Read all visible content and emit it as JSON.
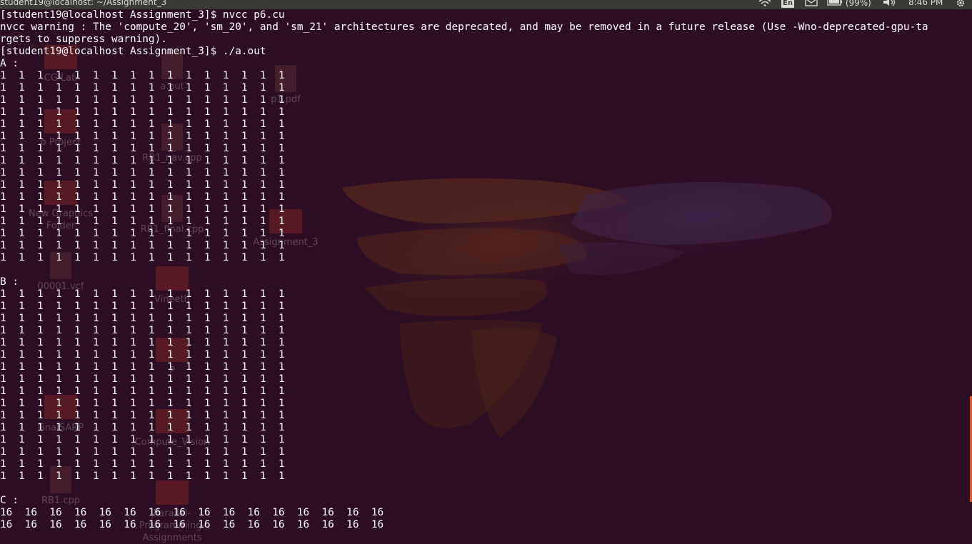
{
  "topbar": {
    "window_title": "student19@localhost: ~/Assignment_3",
    "keyboard": "En",
    "battery": "(99%)",
    "time": "8:46 PM"
  },
  "desktop_icons": [
    {
      "label": "CG Lab",
      "kind": "folder"
    },
    {
      "label": "a.out",
      "kind": "file"
    },
    {
      "label": "p1.pdf",
      "kind": "file"
    },
    {
      "label": "o Project",
      "kind": "folder"
    },
    {
      "label": "RB1_nav.cpp",
      "kind": "file"
    },
    {
      "label": "New Graphics Folder",
      "kind": "folder"
    },
    {
      "label": "RB1_final.cpp",
      "kind": "file"
    },
    {
      "label": "Assignment_3",
      "kind": "folder"
    },
    {
      "label": "00001.vcf",
      "kind": "file"
    },
    {
      "label": "Vineeth",
      "kind": "folder"
    },
    {
      "label": "P",
      "kind": "folder"
    },
    {
      "label": "FinalSARP",
      "kind": "folder"
    },
    {
      "label": "Compute_Vision",
      "kind": "folder"
    },
    {
      "label": "RB1.cpp",
      "kind": "file"
    },
    {
      "label": "Parallel-Programming-Assignments",
      "kind": "folder"
    }
  ],
  "terminal": {
    "lines": [
      "[student19@localhost Assignment_3]$ nvcc p6.cu",
      "nvcc warning : The 'compute_20', 'sm_20', and 'sm_21' architectures are deprecated, and may be removed in a future release (Use -Wno-deprecated-gpu-ta",
      "rgets to suppress warning).",
      "[student19@localhost Assignment_3]$ ./a.out",
      "A :",
      "1  1  1  1  1  1  1  1  1  1  1  1  1  1  1  1",
      "1  1  1  1  1  1  1  1  1  1  1  1  1  1  1  1",
      "1  1  1  1  1  1  1  1  1  1  1  1  1  1  1  1",
      "1  1  1  1  1  1  1  1  1  1  1  1  1  1  1  1",
      "1  1  1  1  1  1  1  1  1  1  1  1  1  1  1  1",
      "1  1  1  1  1  1  1  1  1  1  1  1  1  1  1  1",
      "1  1  1  1  1  1  1  1  1  1  1  1  1  1  1  1",
      "1  1  1  1  1  1  1  1  1  1  1  1  1  1  1  1",
      "1  1  1  1  1  1  1  1  1  1  1  1  1  1  1  1",
      "1  1  1  1  1  1  1  1  1  1  1  1  1  1  1  1",
      "1  1  1  1  1  1  1  1  1  1  1  1  1  1  1  1",
      "1  1  1  1  1  1  1  1  1  1  1  1  1  1  1  1",
      "1  1  1  1  1  1  1  1  1  1  1  1  1  1  1  1",
      "1  1  1  1  1  1  1  1  1  1  1  1  1  1  1  1",
      "1  1  1  1  1  1  1  1  1  1  1  1  1  1  1  1",
      "1  1  1  1  1  1  1  1  1  1  1  1  1  1  1  1",
      "",
      "B :",
      "1  1  1  1  1  1  1  1  1  1  1  1  1  1  1  1",
      "1  1  1  1  1  1  1  1  1  1  1  1  1  1  1  1",
      "1  1  1  1  1  1  1  1  1  1  1  1  1  1  1  1",
      "1  1  1  1  1  1  1  1  1  1  1  1  1  1  1  1",
      "1  1  1  1  1  1  1  1  1  1  1  1  1  1  1  1",
      "1  1  1  1  1  1  1  1  1  1  1  1  1  1  1  1",
      "1  1  1  1  1  1  1  1  1  1  1  1  1  1  1  1",
      "1  1  1  1  1  1  1  1  1  1  1  1  1  1  1  1",
      "1  1  1  1  1  1  1  1  1  1  1  1  1  1  1  1",
      "1  1  1  1  1  1  1  1  1  1  1  1  1  1  1  1",
      "1  1  1  1  1  1  1  1  1  1  1  1  1  1  1  1",
      "1  1  1  1  1  1  1  1  1  1  1  1  1  1  1  1",
      "1  1  1  1  1  1  1  1  1  1  1  1  1  1  1  1",
      "1  1  1  1  1  1  1  1  1  1  1  1  1  1  1  1",
      "1  1  1  1  1  1  1  1  1  1  1  1  1  1  1  1",
      "1  1  1  1  1  1  1  1  1  1  1  1  1  1  1  1",
      "",
      "C :",
      "16  16  16  16  16  16  16  16  16  16  16  16  16  16  16  16",
      "16  16  16  16  16  16  16  16  16  16  16  16  16  16  16  16"
    ]
  }
}
